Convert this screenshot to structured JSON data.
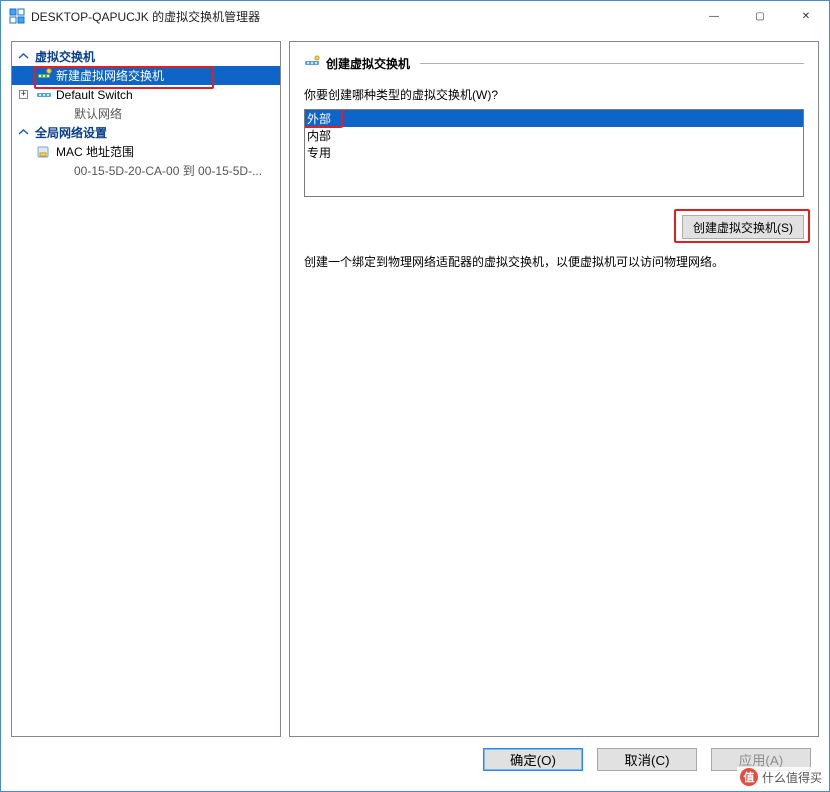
{
  "titlebar": {
    "title": "DESKTOP-QAPUCJK 的虚拟交换机管理器"
  },
  "win_controls": {
    "min": "—",
    "max": "▢",
    "close": "✕"
  },
  "tree": {
    "section1": {
      "title": "虚拟交换机",
      "items": [
        {
          "label": "新建虚拟网络交换机"
        },
        {
          "label": "Default Switch",
          "sub": "默认网络"
        }
      ]
    },
    "section2": {
      "title": "全局网络设置",
      "items": [
        {
          "label": "MAC 地址范围",
          "sub": "00-15-5D-20-CA-00 到 00-15-5D-..."
        }
      ]
    }
  },
  "right": {
    "header": "创建虚拟交换机",
    "prompt": "你要创建哪种类型的虚拟交换机(W)?",
    "options": [
      "外部",
      "内部",
      "专用"
    ],
    "create_btn": "创建虚拟交换机(S)",
    "desc": "创建一个绑定到物理网络适配器的虚拟交换机，以便虚拟机可以访问物理网络。"
  },
  "buttons": {
    "ok": "确定(O)",
    "cancel": "取消(C)",
    "apply": "应用(A)"
  },
  "watermark": {
    "text": "什么值得买"
  },
  "highlight": {
    "color": "#e02020"
  }
}
